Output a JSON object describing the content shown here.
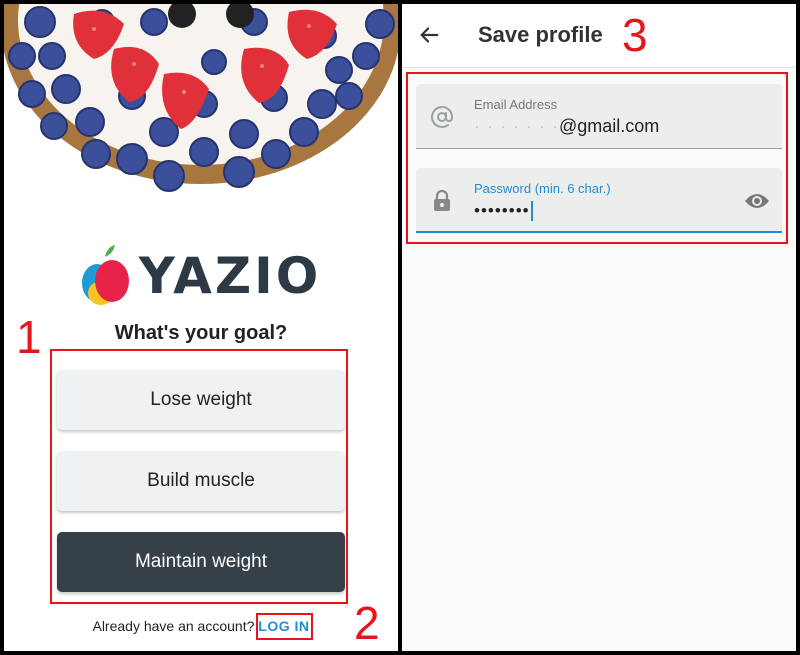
{
  "left_screen": {
    "brand": {
      "name": "YAZIO",
      "colors": {
        "red": "#e8234a",
        "blue": "#1e9bd7",
        "yellow": "#f6c521",
        "leaf": "#4caf50"
      }
    },
    "goal_question": "What's your goal?",
    "goal_options": [
      "Lose weight",
      "Build muscle",
      "Maintain weight"
    ],
    "login_prompt": "Already have an account?",
    "login_link": "LOG IN"
  },
  "right_screen": {
    "title": "Save profile",
    "back_icon": "arrow-left-icon",
    "email_field": {
      "icon": "at-sign-icon",
      "label": "Email Address",
      "masked_part": "· · · · · · ·",
      "value": "@gmail.com"
    },
    "password_field": {
      "icon": "lock-icon",
      "label": "Password (min. 6 char.)",
      "value": "••••••••",
      "toggle_icon": "eye-icon"
    }
  },
  "annotations": {
    "labels": [
      "1",
      "2",
      "3"
    ],
    "color": "#e8141b"
  },
  "theme": {
    "accent": "#1f8ed6",
    "dark_button": "#354049"
  }
}
